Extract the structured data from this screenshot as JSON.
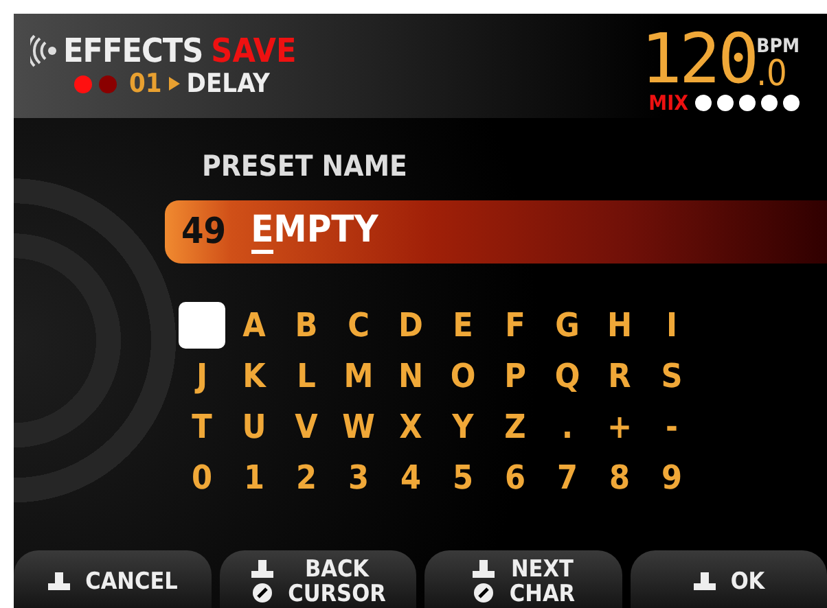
{
  "header": {
    "title": "EFFECTS",
    "mode": "SAVE",
    "leds": [
      {
        "on": true
      },
      {
        "on": false
      }
    ],
    "slot": "01",
    "effect": "DELAY"
  },
  "tempo": {
    "value": "120",
    "decimal": ".0",
    "unit": "BPM",
    "mix_label": "MIX"
  },
  "preset": {
    "label": "PRESET NAME",
    "number": "49",
    "cursor_char": "E",
    "rest": "MPTY"
  },
  "keyboard": {
    "keys": [
      {
        "kind": "space",
        "selected": true
      },
      {
        "kind": "char",
        "label": "A",
        "selected": false
      },
      {
        "kind": "char",
        "label": "B",
        "selected": false
      },
      {
        "kind": "char",
        "label": "C",
        "selected": false
      },
      {
        "kind": "char",
        "label": "D",
        "selected": false
      },
      {
        "kind": "char",
        "label": "E",
        "selected": false
      },
      {
        "kind": "char",
        "label": "F",
        "selected": false
      },
      {
        "kind": "char",
        "label": "G",
        "selected": false
      },
      {
        "kind": "char",
        "label": "H",
        "selected": false
      },
      {
        "kind": "char",
        "label": "I",
        "selected": false
      },
      {
        "kind": "char",
        "label": "J",
        "selected": false
      },
      {
        "kind": "char",
        "label": "K",
        "selected": false
      },
      {
        "kind": "char",
        "label": "L",
        "selected": false
      },
      {
        "kind": "char",
        "label": "M",
        "selected": false
      },
      {
        "kind": "char",
        "label": "N",
        "selected": false
      },
      {
        "kind": "char",
        "label": "O",
        "selected": false
      },
      {
        "kind": "char",
        "label": "P",
        "selected": false
      },
      {
        "kind": "char",
        "label": "Q",
        "selected": false
      },
      {
        "kind": "char",
        "label": "R",
        "selected": false
      },
      {
        "kind": "char",
        "label": "S",
        "selected": false
      },
      {
        "kind": "char",
        "label": "T",
        "selected": false
      },
      {
        "kind": "char",
        "label": "U",
        "selected": false
      },
      {
        "kind": "char",
        "label": "V",
        "selected": false
      },
      {
        "kind": "char",
        "label": "W",
        "selected": false
      },
      {
        "kind": "char",
        "label": "X",
        "selected": false
      },
      {
        "kind": "char",
        "label": "Y",
        "selected": false
      },
      {
        "kind": "char",
        "label": "Z",
        "selected": false
      },
      {
        "kind": "char",
        "label": ".",
        "selected": false
      },
      {
        "kind": "char",
        "label": "+",
        "selected": false
      },
      {
        "kind": "char",
        "label": "-",
        "selected": false
      },
      {
        "kind": "char",
        "label": "0",
        "selected": false
      },
      {
        "kind": "char",
        "label": "1",
        "selected": false
      },
      {
        "kind": "char",
        "label": "2",
        "selected": false
      },
      {
        "kind": "char",
        "label": "3",
        "selected": false
      },
      {
        "kind": "char",
        "label": "4",
        "selected": false
      },
      {
        "kind": "char",
        "label": "5",
        "selected": false
      },
      {
        "kind": "char",
        "label": "6",
        "selected": false
      },
      {
        "kind": "char",
        "label": "7",
        "selected": false
      },
      {
        "kind": "char",
        "label": "8",
        "selected": false
      },
      {
        "kind": "char",
        "label": "9",
        "selected": false
      }
    ]
  },
  "buttons": [
    {
      "kind": "switch",
      "lines": [
        "CANCEL"
      ]
    },
    {
      "kind": "switch-knob",
      "lines": [
        "BACK",
        "CURSOR"
      ]
    },
    {
      "kind": "switch-knob",
      "lines": [
        "NEXT",
        "CHAR"
      ]
    },
    {
      "kind": "switch",
      "lines": [
        "OK"
      ]
    }
  ]
}
